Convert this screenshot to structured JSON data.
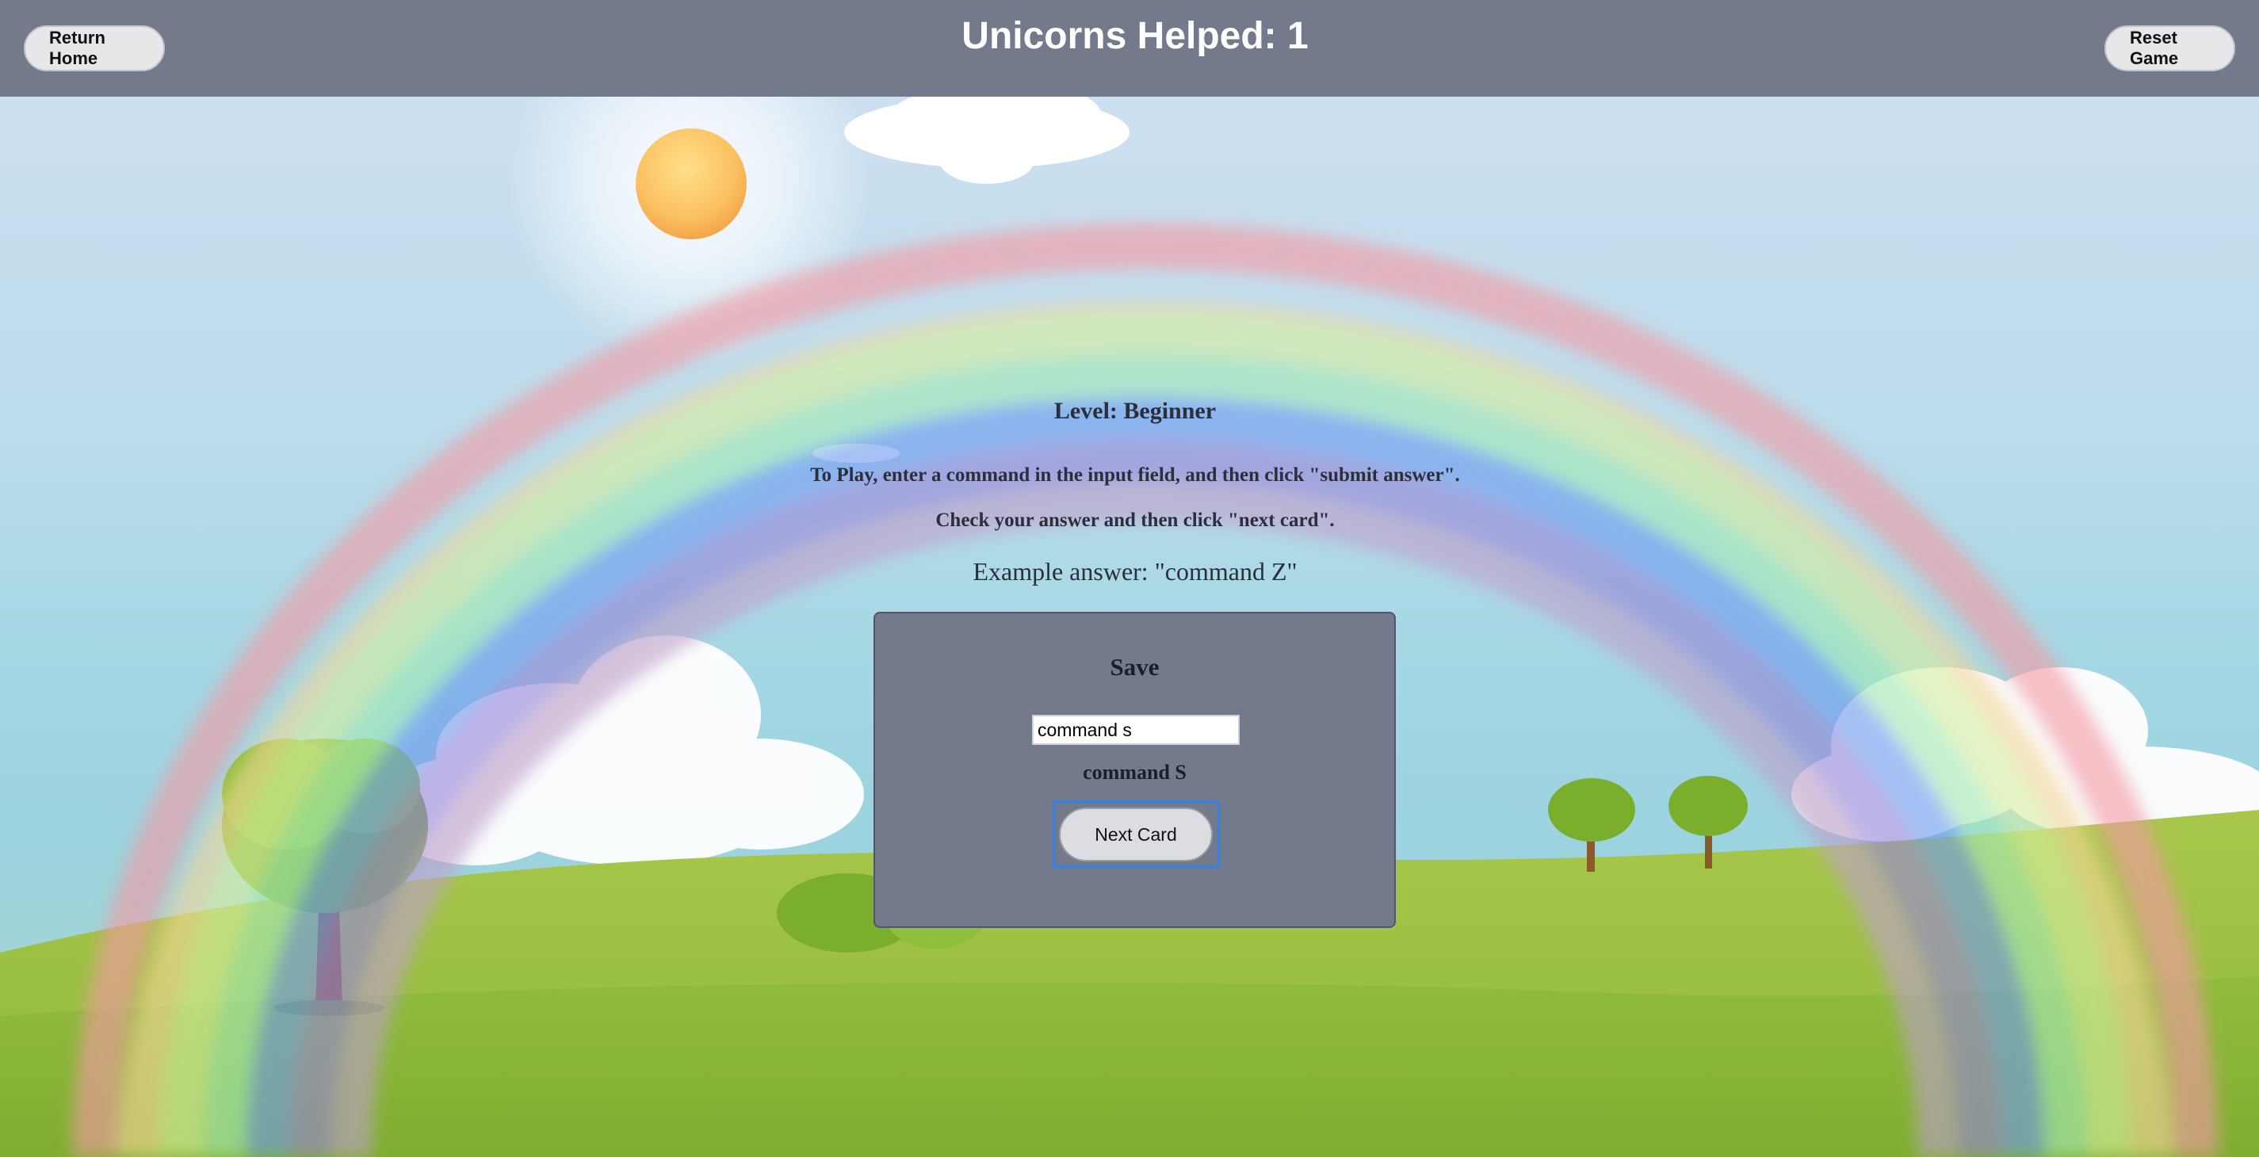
{
  "header": {
    "return_home_label": "Return Home",
    "counter_text": "Unicorns Helped: 1",
    "reset_label": "Reset Game"
  },
  "instructions": {
    "level": "Level: Beginner",
    "line1": "To Play, enter a command in the input field, and then click \"submit answer\".",
    "line2": "Check your answer and then click \"next card\".",
    "example": "Example answer: \"command Z\""
  },
  "card": {
    "title": "Save",
    "input_value": "command s",
    "answer": "command S",
    "next_label": "Next Card"
  },
  "colors": {
    "topbar": "#727a8c",
    "card": "#727a8c",
    "focus_ring": "#3f7fd6"
  }
}
